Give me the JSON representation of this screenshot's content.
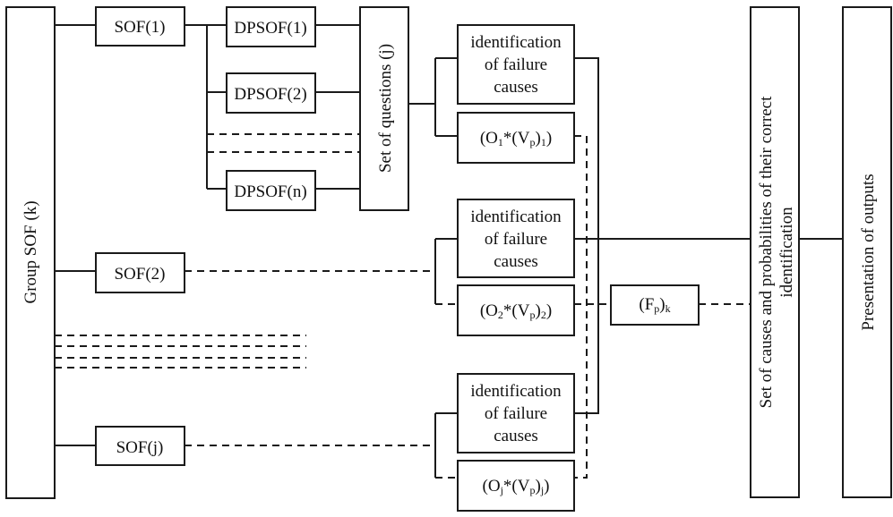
{
  "diagram": {
    "group": {
      "label": "Group SOF (k)"
    },
    "sof": [
      {
        "label": "SOF(1)"
      },
      {
        "label": "SOF(2)"
      },
      {
        "label": "SOF(j)"
      }
    ],
    "dpsof": [
      {
        "label": "DPSOF(1)"
      },
      {
        "label": "DPSOF(2)"
      },
      {
        "label": "DPSOF(n)"
      }
    ],
    "questions": {
      "label": "Set of questions (j)"
    },
    "identification": [
      {
        "line1": "identification",
        "line2": "of failure",
        "line3": "causes"
      },
      {
        "line1": "identification",
        "line2": "of failure",
        "line3": "causes"
      },
      {
        "line1": "identification",
        "line2": "of failure",
        "line3": "causes"
      }
    ],
    "outputs": [
      {
        "o": "(O",
        "o_sub": "1",
        "mid": "*(V",
        "v_sub": "p",
        "close": ")",
        "idx_sub": "1",
        "end": ")"
      },
      {
        "o": "(O",
        "o_sub": "2",
        "mid": "*(V",
        "v_sub": "p",
        "close": ")",
        "idx_sub": "2",
        "end": ")"
      },
      {
        "o": "(O",
        "o_sub": "j",
        "mid": "*(V",
        "v_sub": "p",
        "close": ")",
        "idx_sub": "j",
        "end": ")"
      }
    ],
    "fp": {
      "open": "(F",
      "sub": "p",
      "close": ")",
      "idx": "k"
    },
    "set_of_causes": {
      "line1": "Set of causes and probabilities of their correct",
      "line2": "identification"
    },
    "presentation": {
      "label": "Presentation of outputs"
    }
  }
}
